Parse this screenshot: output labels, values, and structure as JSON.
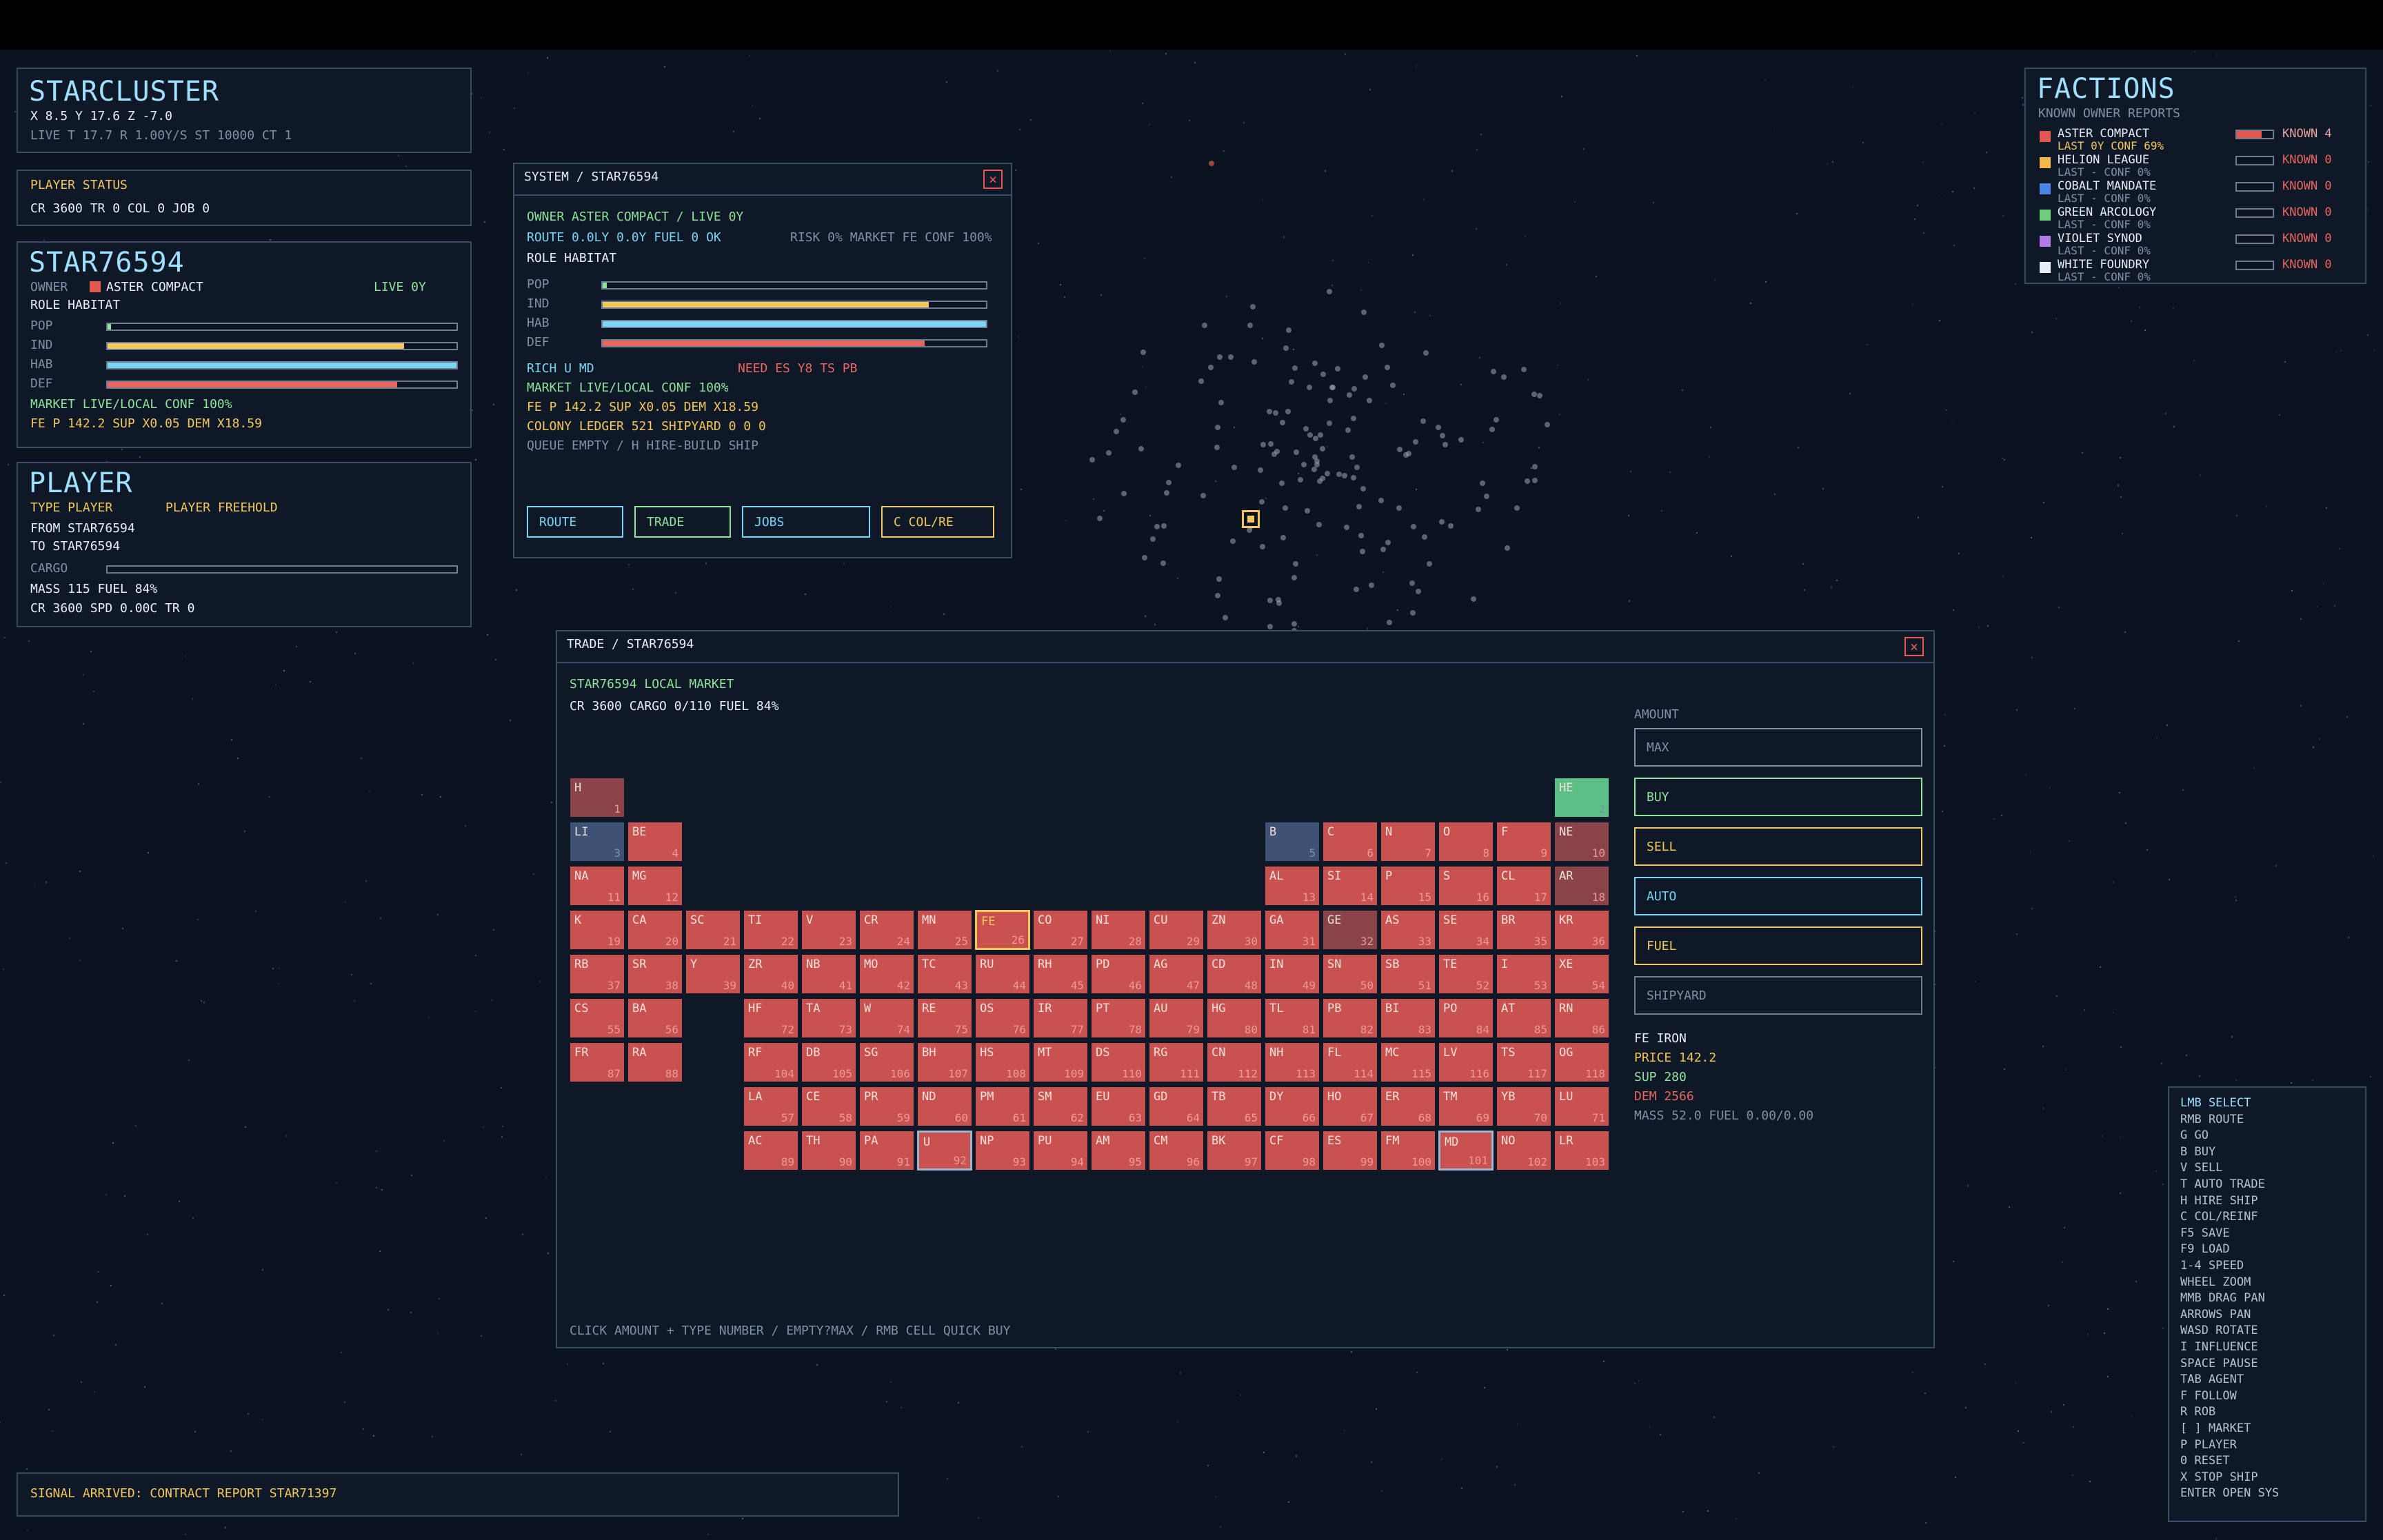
{
  "colors": {
    "bg": "#0c1320",
    "panel": "#0e1827",
    "accent_cyan": "#78d5f5",
    "accent_yellow": "#f3c75b",
    "accent_green": "#8fe39a",
    "accent_red": "#e8665e"
  },
  "starcluster": {
    "title": "STARCLUSTER",
    "coords": "X 8.5  Y 17.6  Z -7.0",
    "status": "LIVE  T 17.7  R 1.00Y/S  ST 10000  CT 1"
  },
  "player_status": {
    "title": "PLAYER STATUS",
    "line": "CR 3600 TR 0 COL 0 JOB 0"
  },
  "star_panel": {
    "title": "STAR76594",
    "owner_label": "OWNER",
    "owner_name": "ASTER COMPACT",
    "live": "LIVE 0Y",
    "role": "ROLE HABITAT",
    "bars": [
      {
        "label": "POP",
        "value": 0.01,
        "color": "#8fe39a"
      },
      {
        "label": "IND",
        "value": 0.85,
        "color": "#f3c75b"
      },
      {
        "label": "HAB",
        "value": 1.0,
        "color": "#78d5f5"
      },
      {
        "label": "DEF",
        "value": 0.83,
        "color": "#e8665e"
      }
    ],
    "market": "MARKET LIVE/LOCAL CONF 100%",
    "price": "FE P 142.2 SUP X0.05 DEM X18.59"
  },
  "player": {
    "title": "PLAYER",
    "type": "TYPE PLAYER",
    "freehold": "PLAYER FREEHOLD",
    "from": "FROM STAR76594",
    "to": "TO   STAR76594",
    "cargo_label": "CARGO",
    "cargo_value": 0,
    "mass": "MASS 115 FUEL 84%",
    "credits": "CR 3600 SPD 0.00C TR 0"
  },
  "system": {
    "title": "SYSTEM / STAR76594",
    "owner": "OWNER ASTER COMPACT / LIVE 0Y",
    "route": "ROUTE 0.0LY 0.0Y FUEL 0 OK",
    "risk": "RISK 0% MARKET FE CONF 100%",
    "role": "ROLE HABITAT",
    "bars": [
      {
        "label": "POP",
        "value": 0.01,
        "color": "#8fe39a"
      },
      {
        "label": "IND",
        "value": 0.85,
        "color": "#f3c75b"
      },
      {
        "label": "HAB",
        "value": 1.0,
        "color": "#78d5f5"
      },
      {
        "label": "DEF",
        "value": 0.84,
        "color": "#e8665e"
      }
    ],
    "rich": "RICH U MD",
    "need": "NEED ES Y8 TS PB",
    "market": "MARKET LIVE/LOCAL CONF 100%",
    "price": "FE P 142.2 SUP X0.05 DEM X18.59",
    "ledger": "COLONY LEDGER 521 SHIPYARD 0 0 0",
    "queue": "QUEUE EMPTY / H HIRE-BUILD SHIP",
    "buttons": {
      "route": "ROUTE",
      "trade": "TRADE",
      "jobs": "JOBS",
      "col": "C COL/RE"
    }
  },
  "factions": {
    "title": "FACTIONS",
    "subtitle": "KNOWN OWNER REPORTS",
    "items": [
      {
        "name": "ASTER COMPACT",
        "note": "LAST 0Y CONF 69%",
        "known": "KNOWN 4",
        "color": "#e05850",
        "fill": 0.7
      },
      {
        "name": "HELION LEAGUE",
        "note": "LAST - CONF 0%",
        "known": "KNOWN 0",
        "color": "#f3b84a",
        "fill": 0
      },
      {
        "name": "COBALT MANDATE",
        "note": "LAST - CONF 0%",
        "known": "KNOWN 0",
        "color": "#4a82e8",
        "fill": 0
      },
      {
        "name": "GREEN ARCOLOGY",
        "note": "LAST - CONF 0%",
        "known": "KNOWN 0",
        "color": "#6fd07a",
        "fill": 0
      },
      {
        "name": "VIOLET SYNOD",
        "note": "LAST - CONF 0%",
        "known": "KNOWN 0",
        "color": "#b07ae8",
        "fill": 0
      },
      {
        "name": "WHITE FOUNDRY",
        "note": "LAST - CONF 0%",
        "known": "KNOWN 0",
        "color": "#e8eef6",
        "fill": 0
      }
    ]
  },
  "trade": {
    "title": "TRADE / STAR76594",
    "market_title": "STAR76594 LOCAL MARKET",
    "status": "CR 3600 CARGO 0/110 FUEL 84%",
    "amount_label": "AMOUNT",
    "amount_placeholder": "MAX",
    "buttons": {
      "buy": "BUY",
      "sell": "SELL",
      "auto": "AUTO",
      "fuel": "FUEL",
      "shipyard": "SHIPYARD"
    },
    "selected": {
      "name": "FE IRON",
      "price": "PRICE 142.2",
      "sup": "SUP 280",
      "dem": "DEM 2566",
      "mass": "MASS 52.0 FUEL 0.00/0.00"
    },
    "hint": "CLICK AMOUNT + TYPE NUMBER / EMPTY?MAX / RMB CELL QUICK BUY",
    "elements": [
      {
        "s": "H",
        "n": 1,
        "r": 0,
        "c": 0,
        "st": "dred"
      },
      {
        "s": "HE",
        "n": 2,
        "r": 0,
        "c": 17,
        "st": "green"
      },
      {
        "s": "LI",
        "n": 3,
        "r": 1,
        "c": 0,
        "st": "blue"
      },
      {
        "s": "BE",
        "n": 4,
        "r": 1,
        "c": 1,
        "st": "red"
      },
      {
        "s": "B",
        "n": 5,
        "r": 1,
        "c": 12,
        "st": "blue"
      },
      {
        "s": "C",
        "n": 6,
        "r": 1,
        "c": 13,
        "st": "red"
      },
      {
        "s": "N",
        "n": 7,
        "r": 1,
        "c": 14,
        "st": "red"
      },
      {
        "s": "O",
        "n": 8,
        "r": 1,
        "c": 15,
        "st": "red"
      },
      {
        "s": "F",
        "n": 9,
        "r": 1,
        "c": 16,
        "st": "red"
      },
      {
        "s": "NE",
        "n": 10,
        "r": 1,
        "c": 17,
        "st": "dred"
      },
      {
        "s": "NA",
        "n": 11,
        "r": 2,
        "c": 0,
        "st": "red"
      },
      {
        "s": "MG",
        "n": 12,
        "r": 2,
        "c": 1,
        "st": "red"
      },
      {
        "s": "AL",
        "n": 13,
        "r": 2,
        "c": 12,
        "st": "red"
      },
      {
        "s": "SI",
        "n": 14,
        "r": 2,
        "c": 13,
        "st": "red"
      },
      {
        "s": "P",
        "n": 15,
        "r": 2,
        "c": 14,
        "st": "red"
      },
      {
        "s": "S",
        "n": 16,
        "r": 2,
        "c": 15,
        "st": "red"
      },
      {
        "s": "CL",
        "n": 17,
        "r": 2,
        "c": 16,
        "st": "red"
      },
      {
        "s": "AR",
        "n": 18,
        "r": 2,
        "c": 17,
        "st": "dred"
      },
      {
        "s": "K",
        "n": 19,
        "r": 3,
        "c": 0,
        "st": "red"
      },
      {
        "s": "CA",
        "n": 20,
        "r": 3,
        "c": 1,
        "st": "red"
      },
      {
        "s": "SC",
        "n": 21,
        "r": 3,
        "c": 2,
        "st": "red"
      },
      {
        "s": "TI",
        "n": 22,
        "r": 3,
        "c": 3,
        "st": "red"
      },
      {
        "s": "V",
        "n": 23,
        "r": 3,
        "c": 4,
        "st": "red"
      },
      {
        "s": "CR",
        "n": 24,
        "r": 3,
        "c": 5,
        "st": "red"
      },
      {
        "s": "MN",
        "n": 25,
        "r": 3,
        "c": 6,
        "st": "red"
      },
      {
        "s": "FE",
        "n": 26,
        "r": 3,
        "c": 7,
        "st": "sel"
      },
      {
        "s": "CO",
        "n": 27,
        "r": 3,
        "c": 8,
        "st": "red"
      },
      {
        "s": "NI",
        "n": 28,
        "r": 3,
        "c": 9,
        "st": "red"
      },
      {
        "s": "CU",
        "n": 29,
        "r": 3,
        "c": 10,
        "st": "red"
      },
      {
        "s": "ZN",
        "n": 30,
        "r": 3,
        "c": 11,
        "st": "red"
      },
      {
        "s": "GA",
        "n": 31,
        "r": 3,
        "c": 12,
        "st": "red"
      },
      {
        "s": "GE",
        "n": 32,
        "r": 3,
        "c": 13,
        "st": "dred"
      },
      {
        "s": "AS",
        "n": 33,
        "r": 3,
        "c": 14,
        "st": "red"
      },
      {
        "s": "SE",
        "n": 34,
        "r": 3,
        "c": 15,
        "st": "red"
      },
      {
        "s": "BR",
        "n": 35,
        "r": 3,
        "c": 16,
        "st": "red"
      },
      {
        "s": "KR",
        "n": 36,
        "r": 3,
        "c": 17,
        "st": "red"
      },
      {
        "s": "RB",
        "n": 37,
        "r": 4,
        "c": 0,
        "st": "red"
      },
      {
        "s": "SR",
        "n": 38,
        "r": 4,
        "c": 1,
        "st": "red"
      },
      {
        "s": "Y",
        "n": 39,
        "r": 4,
        "c": 2,
        "st": "red"
      },
      {
        "s": "ZR",
        "n": 40,
        "r": 4,
        "c": 3,
        "st": "red"
      },
      {
        "s": "NB",
        "n": 41,
        "r": 4,
        "c": 4,
        "st": "red"
      },
      {
        "s": "MO",
        "n": 42,
        "r": 4,
        "c": 5,
        "st": "red"
      },
      {
        "s": "TC",
        "n": 43,
        "r": 4,
        "c": 6,
        "st": "red"
      },
      {
        "s": "RU",
        "n": 44,
        "r": 4,
        "c": 7,
        "st": "red"
      },
      {
        "s": "RH",
        "n": 45,
        "r": 4,
        "c": 8,
        "st": "red"
      },
      {
        "s": "PD",
        "n": 46,
        "r": 4,
        "c": 9,
        "st": "red"
      },
      {
        "s": "AG",
        "n": 47,
        "r": 4,
        "c": 10,
        "st": "red"
      },
      {
        "s": "CD",
        "n": 48,
        "r": 4,
        "c": 11,
        "st": "red"
      },
      {
        "s": "IN",
        "n": 49,
        "r": 4,
        "c": 12,
        "st": "red"
      },
      {
        "s": "SN",
        "n": 50,
        "r": 4,
        "c": 13,
        "st": "red"
      },
      {
        "s": "SB",
        "n": 51,
        "r": 4,
        "c": 14,
        "st": "red"
      },
      {
        "s": "TE",
        "n": 52,
        "r": 4,
        "c": 15,
        "st": "red"
      },
      {
        "s": "I",
        "n": 53,
        "r": 4,
        "c": 16,
        "st": "red"
      },
      {
        "s": "XE",
        "n": 54,
        "r": 4,
        "c": 17,
        "st": "red"
      },
      {
        "s": "CS",
        "n": 55,
        "r": 5,
        "c": 0,
        "st": "red"
      },
      {
        "s": "BA",
        "n": 56,
        "r": 5,
        "c": 1,
        "st": "red"
      },
      {
        "s": "HF",
        "n": 72,
        "r": 5,
        "c": 3,
        "st": "red"
      },
      {
        "s": "TA",
        "n": 73,
        "r": 5,
        "c": 4,
        "st": "red"
      },
      {
        "s": "W",
        "n": 74,
        "r": 5,
        "c": 5,
        "st": "red"
      },
      {
        "s": "RE",
        "n": 75,
        "r": 5,
        "c": 6,
        "st": "red"
      },
      {
        "s": "OS",
        "n": 76,
        "r": 5,
        "c": 7,
        "st": "red"
      },
      {
        "s": "IR",
        "n": 77,
        "r": 5,
        "c": 8,
        "st": "red"
      },
      {
        "s": "PT",
        "n": 78,
        "r": 5,
        "c": 9,
        "st": "red"
      },
      {
        "s": "AU",
        "n": 79,
        "r": 5,
        "c": 10,
        "st": "red"
      },
      {
        "s": "HG",
        "n": 80,
        "r": 5,
        "c": 11,
        "st": "red"
      },
      {
        "s": "TL",
        "n": 81,
        "r": 5,
        "c": 12,
        "st": "red"
      },
      {
        "s": "PB",
        "n": 82,
        "r": 5,
        "c": 13,
        "st": "red"
      },
      {
        "s": "BI",
        "n": 83,
        "r": 5,
        "c": 14,
        "st": "red"
      },
      {
        "s": "PO",
        "n": 84,
        "r": 5,
        "c": 15,
        "st": "red"
      },
      {
        "s": "AT",
        "n": 85,
        "r": 5,
        "c": 16,
        "st": "red"
      },
      {
        "s": "RN",
        "n": 86,
        "r": 5,
        "c": 17,
        "st": "red"
      },
      {
        "s": "FR",
        "n": 87,
        "r": 6,
        "c": 0,
        "st": "red"
      },
      {
        "s": "RA",
        "n": 88,
        "r": 6,
        "c": 1,
        "st": "red"
      },
      {
        "s": "RF",
        "n": 104,
        "r": 6,
        "c": 3,
        "st": "red"
      },
      {
        "s": "DB",
        "n": 105,
        "r": 6,
        "c": 4,
        "st": "red"
      },
      {
        "s": "SG",
        "n": 106,
        "r": 6,
        "c": 5,
        "st": "red"
      },
      {
        "s": "BH",
        "n": 107,
        "r": 6,
        "c": 6,
        "st": "red"
      },
      {
        "s": "HS",
        "n": 108,
        "r": 6,
        "c": 7,
        "st": "red"
      },
      {
        "s": "MT",
        "n": 109,
        "r": 6,
        "c": 8,
        "st": "red"
      },
      {
        "s": "DS",
        "n": 110,
        "r": 6,
        "c": 9,
        "st": "red"
      },
      {
        "s": "RG",
        "n": 111,
        "r": 6,
        "c": 10,
        "st": "red"
      },
      {
        "s": "CN",
        "n": 112,
        "r": 6,
        "c": 11,
        "st": "red"
      },
      {
        "s": "NH",
        "n": 113,
        "r": 6,
        "c": 12,
        "st": "red"
      },
      {
        "s": "FL",
        "n": 114,
        "r": 6,
        "c": 13,
        "st": "red"
      },
      {
        "s": "MC",
        "n": 115,
        "r": 6,
        "c": 14,
        "st": "red"
      },
      {
        "s": "LV",
        "n": 116,
        "r": 6,
        "c": 15,
        "st": "red"
      },
      {
        "s": "TS",
        "n": 117,
        "r": 6,
        "c": 16,
        "st": "red"
      },
      {
        "s": "OG",
        "n": 118,
        "r": 6,
        "c": 17,
        "st": "red"
      },
      {
        "s": "LA",
        "n": 57,
        "r": 7,
        "c": 3,
        "st": "red"
      },
      {
        "s": "CE",
        "n": 58,
        "r": 7,
        "c": 4,
        "st": "red"
      },
      {
        "s": "PR",
        "n": 59,
        "r": 7,
        "c": 5,
        "st": "red"
      },
      {
        "s": "ND",
        "n": 60,
        "r": 7,
        "c": 6,
        "st": "red"
      },
      {
        "s": "PM",
        "n": 61,
        "r": 7,
        "c": 7,
        "st": "red"
      },
      {
        "s": "SM",
        "n": 62,
        "r": 7,
        "c": 8,
        "st": "red"
      },
      {
        "s": "EU",
        "n": 63,
        "r": 7,
        "c": 9,
        "st": "red"
      },
      {
        "s": "GD",
        "n": 64,
        "r": 7,
        "c": 10,
        "st": "red"
      },
      {
        "s": "TB",
        "n": 65,
        "r": 7,
        "c": 11,
        "st": "red"
      },
      {
        "s": "DY",
        "n": 66,
        "r": 7,
        "c": 12,
        "st": "red"
      },
      {
        "s": "HO",
        "n": 67,
        "r": 7,
        "c": 13,
        "st": "red"
      },
      {
        "s": "ER",
        "n": 68,
        "r": 7,
        "c": 14,
        "st": "red"
      },
      {
        "s": "TM",
        "n": 69,
        "r": 7,
        "c": 15,
        "st": "red"
      },
      {
        "s": "YB",
        "n": 70,
        "r": 7,
        "c": 16,
        "st": "red"
      },
      {
        "s": "LU",
        "n": 71,
        "r": 7,
        "c": 17,
        "st": "red"
      },
      {
        "s": "AC",
        "n": 89,
        "r": 8,
        "c": 3,
        "st": "red"
      },
      {
        "s": "TH",
        "n": 90,
        "r": 8,
        "c": 4,
        "st": "red"
      },
      {
        "s": "PA",
        "n": 91,
        "r": 8,
        "c": 5,
        "st": "red"
      },
      {
        "s": "U",
        "n": 92,
        "r": 8,
        "c": 6,
        "st": "rich"
      },
      {
        "s": "NP",
        "n": 93,
        "r": 8,
        "c": 7,
        "st": "red"
      },
      {
        "s": "PU",
        "n": 94,
        "r": 8,
        "c": 8,
        "st": "red"
      },
      {
        "s": "AM",
        "n": 95,
        "r": 8,
        "c": 9,
        "st": "red"
      },
      {
        "s": "CM",
        "n": 96,
        "r": 8,
        "c": 10,
        "st": "red"
      },
      {
        "s": "BK",
        "n": 97,
        "r": 8,
        "c": 11,
        "st": "red"
      },
      {
        "s": "CF",
        "n": 98,
        "r": 8,
        "c": 12,
        "st": "red"
      },
      {
        "s": "ES",
        "n": 99,
        "r": 8,
        "c": 13,
        "st": "red"
      },
      {
        "s": "FM",
        "n": 100,
        "r": 8,
        "c": 14,
        "st": "red"
      },
      {
        "s": "MD",
        "n": 101,
        "r": 8,
        "c": 15,
        "st": "rich"
      },
      {
        "s": "NO",
        "n": 102,
        "r": 8,
        "c": 16,
        "st": "red"
      },
      {
        "s": "LR",
        "n": 103,
        "r": 8,
        "c": 17,
        "st": "red"
      }
    ]
  },
  "signal": "SIGNAL ARRIVED: CONTRACT REPORT STAR71397",
  "help": [
    "LMB SELECT",
    "RMB ROUTE",
    "G GO",
    "B BUY",
    "V SELL",
    "T AUTO TRADE",
    "H HIRE SHIP",
    "C COL/REINF",
    "F5 SAVE",
    "F9 LOAD",
    "1-4 SPEED",
    "WHEEL ZOOM",
    "MMB DRAG PAN",
    "ARROWS PAN",
    "WASD ROTATE",
    "I INFLUENCE",
    "SPACE PAUSE",
    "TAB AGENT",
    "F FOLLOW",
    "R ROB",
    "[ ] MARKET",
    "P PLAYER",
    "0 RESET",
    "X STOP SHIP",
    "ENTER OPEN SYS"
  ]
}
